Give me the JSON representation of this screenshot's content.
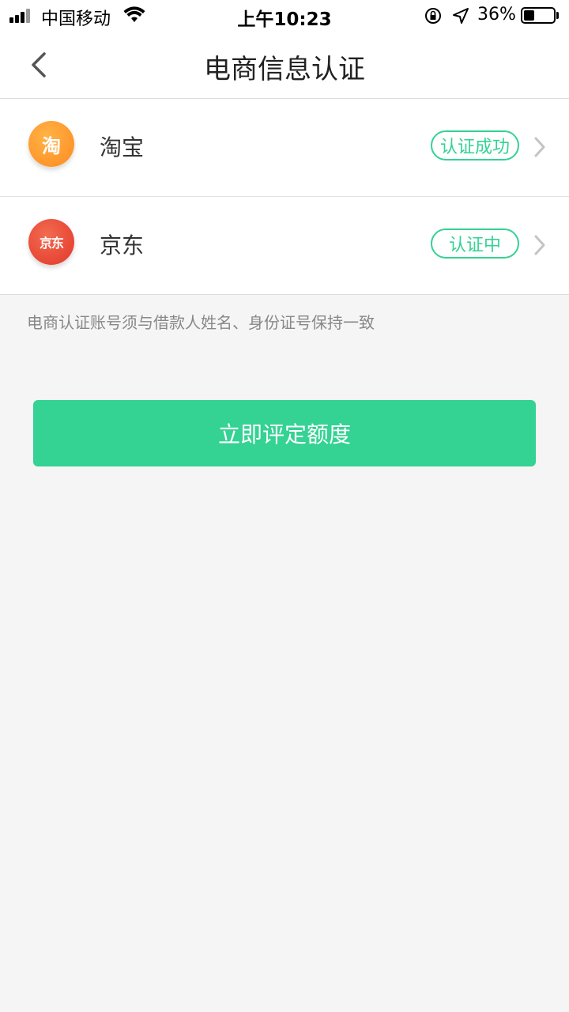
{
  "status_bar": {
    "carrier": "中国移动",
    "time": "上午10:23",
    "battery": "36%",
    "battery_level": 0.36
  },
  "nav": {
    "title": "电商信息认证",
    "back_icon": "chevron-left-icon"
  },
  "platforms": [
    {
      "name": "淘宝",
      "logo_text": "淘",
      "status": "认证成功",
      "logo_color": "#ff9a2e"
    },
    {
      "name": "京东",
      "logo_text": "京东",
      "status": "认证中",
      "logo_color": "#e8432f"
    }
  ],
  "tip": "电商认证账号须与借款人姓名、身份证号保持一致",
  "cta_label": "立即评定额度",
  "colors": {
    "accent": "#34d293",
    "background": "#f5f5f5"
  }
}
